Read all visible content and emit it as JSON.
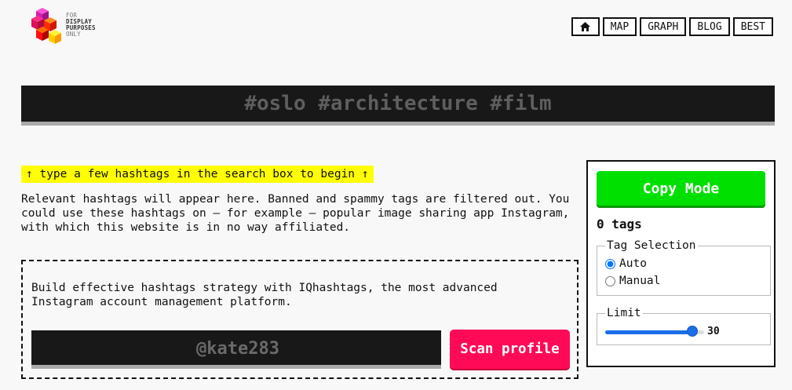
{
  "logo": {
    "lines": [
      "FOR",
      "DISPLAY",
      "PURPOSES",
      "ONLY"
    ]
  },
  "nav": {
    "home_icon": "home-icon",
    "items": [
      "MAP",
      "GRAPH",
      "BLOG",
      "BEST"
    ]
  },
  "search": {
    "value": "#oslo #architecture #film"
  },
  "hint": "↑ type a few hashtags in the search box to begin ↑",
  "description": "Relevant hashtags will appear here. Banned and spammy tags are filtered out. You could use these hashtags on — for example — popular image sharing app Instagram, with which this website is in no way affiliated.",
  "promo": {
    "text": "Build effective hashtags strategy with IQhashtags, the most advanced Instagram account management platform.",
    "profile_value": "@kate283",
    "scan_label": "Scan profile"
  },
  "sidebar": {
    "copy_label": "Copy Mode",
    "tag_count": "0 tags",
    "selection_legend": "Tag Selection",
    "options": [
      "Auto",
      "Manual"
    ],
    "selected_option": "Auto",
    "limit_legend": "Limit",
    "limit_value": "30",
    "limit_fraction": 0.88
  },
  "colors": {
    "accent_green": "#00e000",
    "scan_pink": "#ff0a57",
    "hint_yellow": "#ffff00",
    "slider_blue": "#1a6ee8"
  }
}
